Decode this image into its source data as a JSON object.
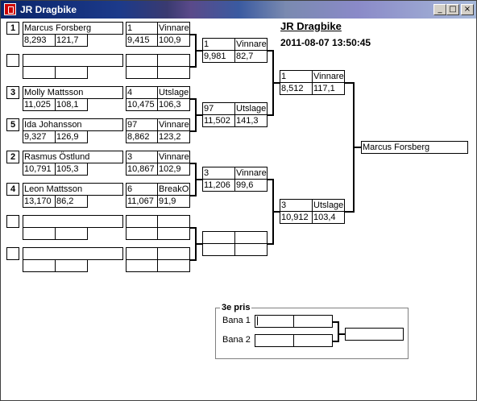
{
  "window": {
    "title": "JR Dragbike",
    "minimize": "_",
    "maximize": "□",
    "close": "×"
  },
  "header": {
    "title": "JR Dragbike",
    "datetime": "2011-08-07 13:50:45"
  },
  "round1": [
    {
      "seed": "1",
      "name": "Marcus Forsberg",
      "time": "8,293",
      "speed": "121,7"
    },
    {
      "seed": "",
      "name": "",
      "time": "",
      "speed": ""
    },
    {
      "seed": "3",
      "name": "Molly Mattsson",
      "time": "11,025",
      "speed": "108,1"
    },
    {
      "seed": "5",
      "name": "Ida Johansson",
      "time": "9,327",
      "speed": "126,9"
    },
    {
      "seed": "2",
      "name": "Rasmus Östlund",
      "time": "10,791",
      "speed": "105,3"
    },
    {
      "seed": "4",
      "name": "Leon Mattsson",
      "time": "13,170",
      "speed": "86,2"
    },
    {
      "seed": "",
      "name": "",
      "time": "",
      "speed": ""
    },
    {
      "seed": "",
      "name": "",
      "time": "",
      "speed": ""
    }
  ],
  "round2": [
    {
      "lane": "1",
      "result": "Vinnare",
      "time": "9,415",
      "speed": "100,9"
    },
    {
      "lane": "",
      "result": "",
      "time": "",
      "speed": ""
    },
    {
      "lane": "4",
      "result": "Utslagen",
      "time": "10,475",
      "speed": "106,3"
    },
    {
      "lane": "97",
      "result": "Vinnare",
      "time": "8,862",
      "speed": "123,2"
    },
    {
      "lane": "3",
      "result": "Vinnare",
      "time": "10,867",
      "speed": "102,9"
    },
    {
      "lane": "6",
      "result": "BreakOut",
      "time": "11,067",
      "speed": "91,9"
    },
    {
      "lane": "",
      "result": "",
      "time": "",
      "speed": ""
    },
    {
      "lane": "",
      "result": "",
      "time": "",
      "speed": ""
    }
  ],
  "round3": [
    {
      "lane": "1",
      "result": "Vinnare",
      "time": "9,981",
      "speed": "82,7"
    },
    {
      "lane": "97",
      "result": "Utslagen",
      "time": "11,502",
      "speed": "141,3"
    },
    {
      "lane": "3",
      "result": "Vinnare",
      "time": "11,206",
      "speed": "99,6"
    },
    {
      "lane": "",
      "result": "",
      "time": "",
      "speed": ""
    }
  ],
  "round4": [
    {
      "lane": "1",
      "result": "Vinnare",
      "time": "8,512",
      "speed": "117,1"
    },
    {
      "lane": "3",
      "result": "Utslagen",
      "time": "10,912",
      "speed": "103,4"
    }
  ],
  "winner": "Marcus Forsberg",
  "third_place": {
    "label": "3e pris",
    "lane1_label": "Bana 1",
    "lane2_label": "Bana 2",
    "lane1": {
      "a": "",
      "b": ""
    },
    "lane2": {
      "a": "",
      "b": ""
    },
    "winner": ""
  }
}
